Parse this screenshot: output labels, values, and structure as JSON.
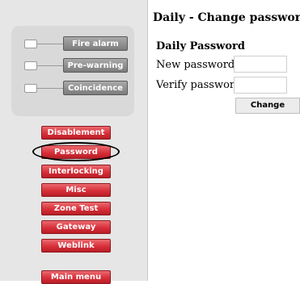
{
  "page_title": "Daily - Change password",
  "status_panel": [
    {
      "label": "Fire alarm"
    },
    {
      "label": "Pre-warning"
    },
    {
      "label": "Coincidence"
    }
  ],
  "menu": {
    "items": [
      {
        "label": "Disablement"
      },
      {
        "label": "Password",
        "selected": true
      },
      {
        "label": "Interlocking"
      },
      {
        "label": "Misc"
      },
      {
        "label": "Zone Test"
      },
      {
        "label": "Gateway"
      },
      {
        "label": "Weblink"
      }
    ],
    "main_menu_label": "Main menu"
  },
  "form": {
    "section_title": "Daily Password",
    "new_password_label": "New password",
    "new_password_value": "",
    "verify_password_label": "Verify password",
    "verify_password_value": "",
    "change_button_label": "Change"
  },
  "colors": {
    "menu_button": "#d8303a",
    "status_label": "#8f8f8f",
    "sidebar_background": "#e6e6e6"
  }
}
